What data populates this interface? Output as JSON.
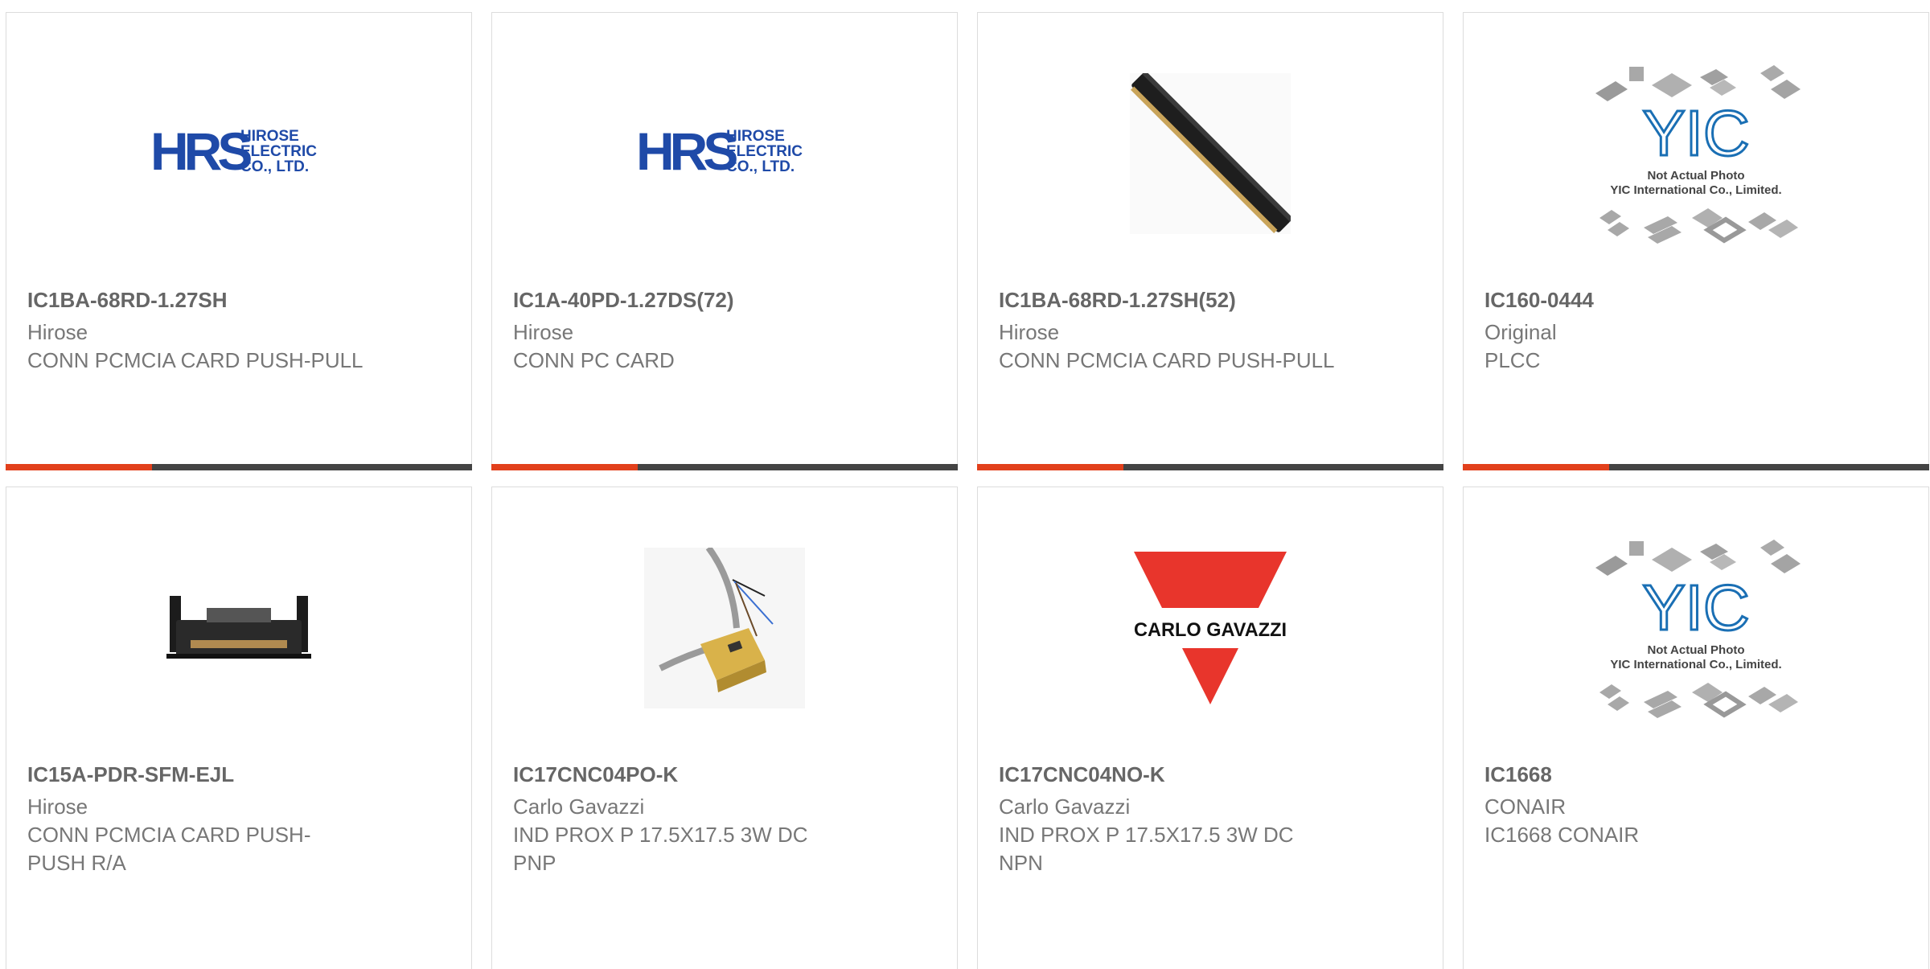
{
  "colors": {
    "accent": "#e2401c",
    "bar": "#444444",
    "text": "#777777",
    "title": "#666666",
    "hrs_blue": "#1f4aa8",
    "carlo_red": "#e8352c",
    "yic_blue": "#1a6fb4"
  },
  "logos": {
    "hrs": {
      "mark": "HRS",
      "line1": "HIROSE",
      "line2": "ELECTRIC",
      "line3": "CO., LTD."
    },
    "yic": {
      "mark": "YIC",
      "caption1": "Not Actual Photo",
      "caption2": "YIC International Co., Limited."
    },
    "carlo": {
      "text": "CARLO GAVAZZI"
    }
  },
  "products": [
    {
      "part": "IC1BA-68RD-1.27SH",
      "maker": "Hirose",
      "desc": "CONN PCMCIA CARD PUSH-PULL",
      "image": "hirose-logo"
    },
    {
      "part": "IC1A-40PD-1.27DS(72)",
      "maker": "Hirose",
      "desc": "CONN PC CARD",
      "image": "hirose-logo"
    },
    {
      "part": "IC1BA-68RD-1.27SH(52)",
      "maker": "Hirose",
      "desc": "CONN PCMCIA CARD PUSH-PULL",
      "image": "connector-photo"
    },
    {
      "part": "IC160-0444",
      "maker": "Original",
      "desc": "PLCC",
      "image": "not-actual-photo"
    },
    {
      "part": "IC15A-PDR-SFM-EJL",
      "maker": "Hirose",
      "desc": "CONN PCMCIA CARD PUSH-PUSH R/A",
      "image": "pcmcia-header-photo"
    },
    {
      "part": "IC17CNC04PO-K",
      "maker": "Carlo Gavazzi",
      "desc": "IND PROX P 17.5X17.5 3W DC PNP",
      "image": "prox-sensor-photo"
    },
    {
      "part": "IC17CNC04NO-K",
      "maker": "Carlo Gavazzi",
      "desc": "IND PROX P 17.5X17.5 3W DC NPN",
      "image": "carlo-gavazzi-logo"
    },
    {
      "part": "IC1668",
      "maker": "CONAIR",
      "desc": "IC1668 CONAIR",
      "image": "not-actual-photo"
    }
  ]
}
